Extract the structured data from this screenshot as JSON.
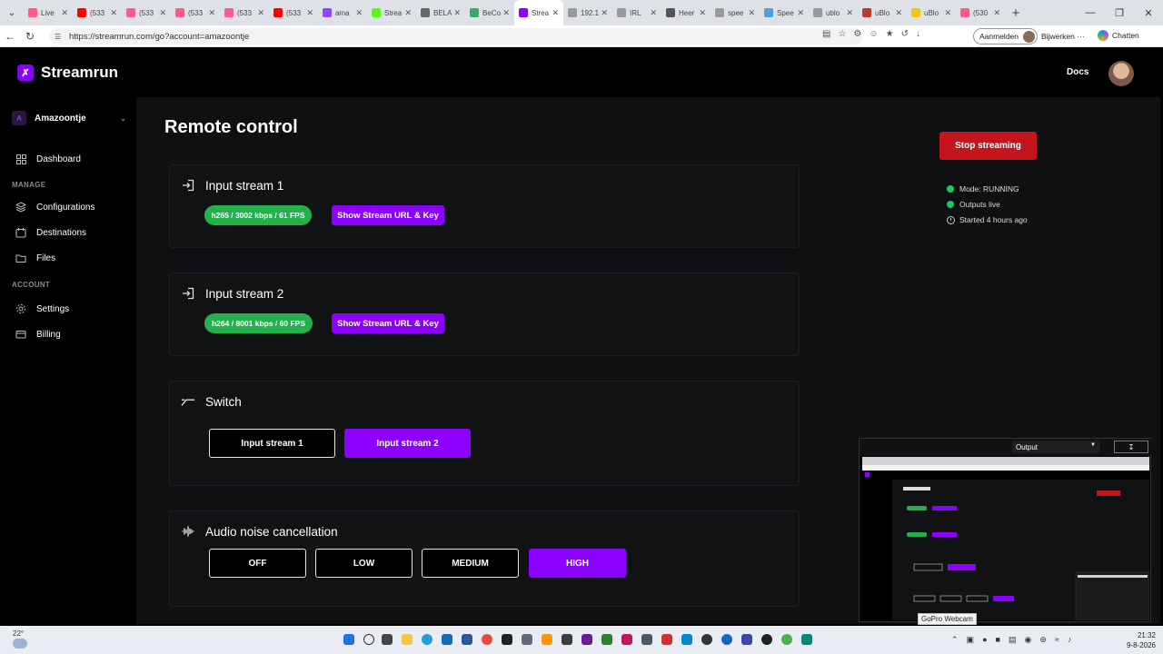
{
  "browser": {
    "tabs": [
      {
        "title": "Live",
        "color": "#ff5a8a"
      },
      {
        "title": "(533",
        "color": "#ff0000"
      },
      {
        "title": "(533",
        "color": "#ff5a8a"
      },
      {
        "title": "(533",
        "color": "#ff5a8a"
      },
      {
        "title": "(533",
        "color": "#ff5a8a"
      },
      {
        "title": "(533",
        "color": "#ff0000"
      },
      {
        "title": "ama",
        "color": "#9146ff"
      },
      {
        "title": "Strea",
        "color": "#53fc18"
      },
      {
        "title": "BELA",
        "color": "#666666"
      },
      {
        "title": "BeCo",
        "color": "#3aa76d"
      },
      {
        "title": "Strea",
        "color": "#8b00ff"
      },
      {
        "title": "192.1",
        "color": "#999999"
      },
      {
        "title": "IRL",
        "color": "#999999"
      },
      {
        "title": "Heer",
        "color": "#555555"
      },
      {
        "title": "spee",
        "color": "#999999"
      },
      {
        "title": "Spee",
        "color": "#4aa3df"
      },
      {
        "title": "ublo",
        "color": "#999999"
      },
      {
        "title": "uBlo",
        "color": "#c0392b"
      },
      {
        "title": "uBlo",
        "color": "#f1c40f"
      },
      {
        "title": "(530",
        "color": "#ff5a8a"
      }
    ],
    "active_tab_index": 10,
    "url": "https://streamrun.com/go?account=amazoontje",
    "signin_label": "Aanmelden",
    "update_label": "Bijwerken",
    "chat_label": "Chatten"
  },
  "app": {
    "brand": "Streamrun",
    "brand_color": "#8b00ff",
    "docs_label": "Docs",
    "account": {
      "initial": "A",
      "name": "Amazoontje"
    },
    "nav": {
      "dashboard": "Dashboard",
      "manage_header": "MANAGE",
      "configurations": "Configurations",
      "destinations": "Destinations",
      "files": "Files",
      "account_header": "ACCOUNT",
      "settings": "Settings",
      "billing": "Billing"
    },
    "page_title": "Remote control",
    "inputs": [
      {
        "title": "Input stream 1",
        "stats": "h265 / 3002 kbps / 61 FPS",
        "button": "Show Stream URL & Key"
      },
      {
        "title": "Input stream 2",
        "stats": "h264 / 8001 kbps / 60 FPS",
        "button": "Show Stream URL & Key"
      }
    ],
    "switch": {
      "title": "Switch",
      "options": [
        "Input stream 1",
        "Input stream 2"
      ],
      "selected": "Input stream 2"
    },
    "noise": {
      "title": "Audio noise cancellation",
      "options": [
        "OFF",
        "LOW",
        "MEDIUM",
        "HIGH"
      ],
      "selected": "HIGH"
    },
    "stop_button": "Stop streaming",
    "stop_color": "#c4151c",
    "status": {
      "mode": "Mode: RUNNING",
      "outputs": "Outputs live",
      "started": "Started 4 hours ago"
    }
  },
  "preview": {
    "select_value": "Output",
    "download_icon": "download-icon",
    "label": "GoPro Webcam"
  },
  "taskbar": {
    "temperature": "22°",
    "time": "21:32",
    "date": "9-8-2026"
  }
}
